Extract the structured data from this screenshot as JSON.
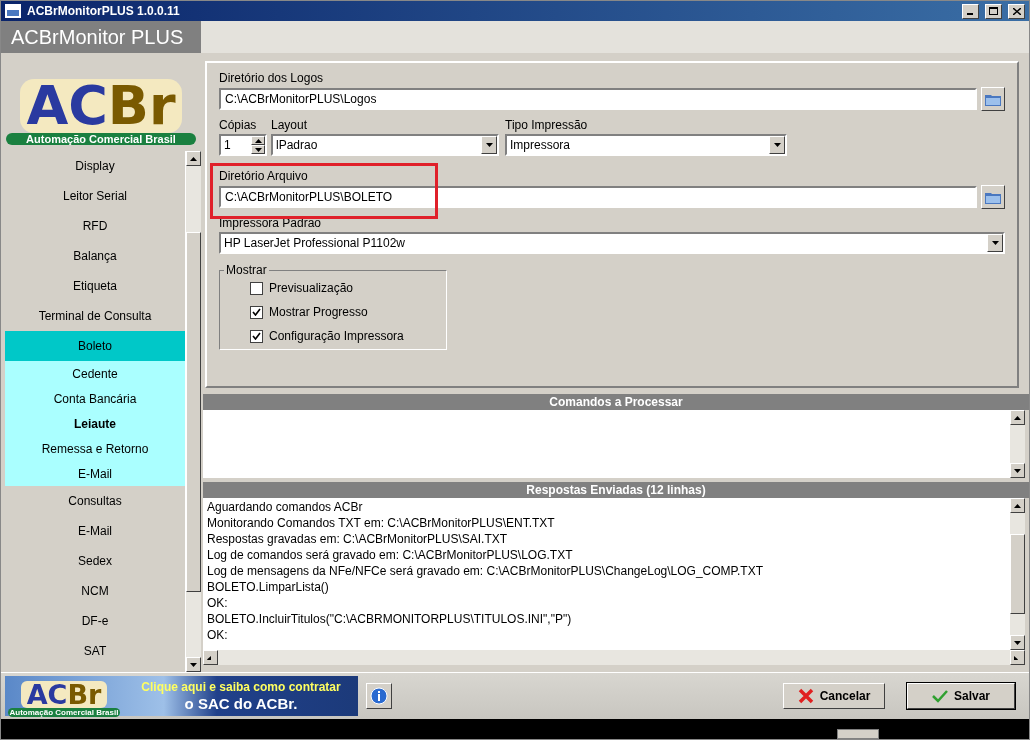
{
  "window": {
    "title": "ACBrMonitorPLUS 1.0.0.11"
  },
  "app_header": "ACBrMonitor PLUS",
  "logo": {
    "mark_left": "AC",
    "mark_right": "Br",
    "tagline": "Automação Comercial Brasil"
  },
  "sidebar": {
    "items": [
      {
        "label": "Display",
        "selected": false
      },
      {
        "label": "Leitor Serial",
        "selected": false
      },
      {
        "label": "RFD",
        "selected": false
      },
      {
        "label": "Balança",
        "selected": false
      },
      {
        "label": "Etiqueta",
        "selected": false
      },
      {
        "label": "Terminal de Consulta",
        "selected": false
      },
      {
        "label": "Boleto",
        "selected": true,
        "children": [
          {
            "label": "Cedente",
            "selected": false
          },
          {
            "label": "Conta Bancária",
            "selected": false
          },
          {
            "label": "Leiaute",
            "selected": true
          },
          {
            "label": "Remessa e Retorno",
            "selected": false
          },
          {
            "label": "E-Mail",
            "selected": false
          }
        ]
      },
      {
        "label": "Consultas",
        "selected": false
      },
      {
        "label": "E-Mail",
        "selected": false
      },
      {
        "label": "Sedex",
        "selected": false
      },
      {
        "label": "NCM",
        "selected": false
      },
      {
        "label": "DF-e",
        "selected": false
      },
      {
        "label": "SAT",
        "selected": false
      }
    ]
  },
  "form": {
    "logos_dir": {
      "label": "Diretório dos Logos",
      "value": "C:\\ACBrMonitorPLUS\\Logos"
    },
    "copies": {
      "label": "Cópias",
      "value": "1"
    },
    "layout": {
      "label": "Layout",
      "value": "lPadrao"
    },
    "print_type": {
      "label": "Tipo Impressão",
      "value": "Impressora"
    },
    "file_dir": {
      "label": "Diretório Arquivo",
      "value": "C:\\ACBrMonitorPLUS\\BOLETO",
      "highlighted": true
    },
    "printer": {
      "label": "Impressora Padrao",
      "value": "HP LaserJet Professional P1102w"
    },
    "show_group": {
      "title": "Mostrar",
      "options": [
        {
          "label": "Previsualização",
          "checked": false
        },
        {
          "label": "Mostrar Progresso",
          "checked": true
        },
        {
          "label": "Configuração Impressora",
          "checked": true
        }
      ]
    }
  },
  "commands": {
    "title": "Comandos a Processar"
  },
  "responses": {
    "title": "Respostas Enviadas (12 linhas)",
    "lines": [
      "Aguardando comandos ACBr",
      "Monitorando Comandos TXT em: C:\\ACBrMonitorPLUS\\ENT.TXT",
      "Respostas gravadas em: C:\\ACBrMonitorPLUS\\SAI.TXT",
      "Log de comandos será gravado em: C:\\ACBrMonitorPLUS\\LOG.TXT",
      "Log de mensagens da NFe/NFCe será gravado em: C:\\ACBrMonitorPLUS\\ChangeLog\\LOG_COMP.TXT",
      "BOLETO.LimparLista()",
      "OK:",
      "BOLETO.IncluirTitulos(\"C:\\ACBRMONITORPLUS\\TITULOS.INI\",\"P\")",
      "OK:"
    ]
  },
  "banner": {
    "logo_left": "AC",
    "logo_right": "Br",
    "tagline": "Automação Comercial Brasil",
    "line1": "Clique aqui e saiba como contratar",
    "line2": "o SAC do ACBr."
  },
  "buttons": [
    {
      "kind": "cancel",
      "label": "Cancelar"
    },
    {
      "kind": "save",
      "label": "Salvar"
    }
  ]
}
